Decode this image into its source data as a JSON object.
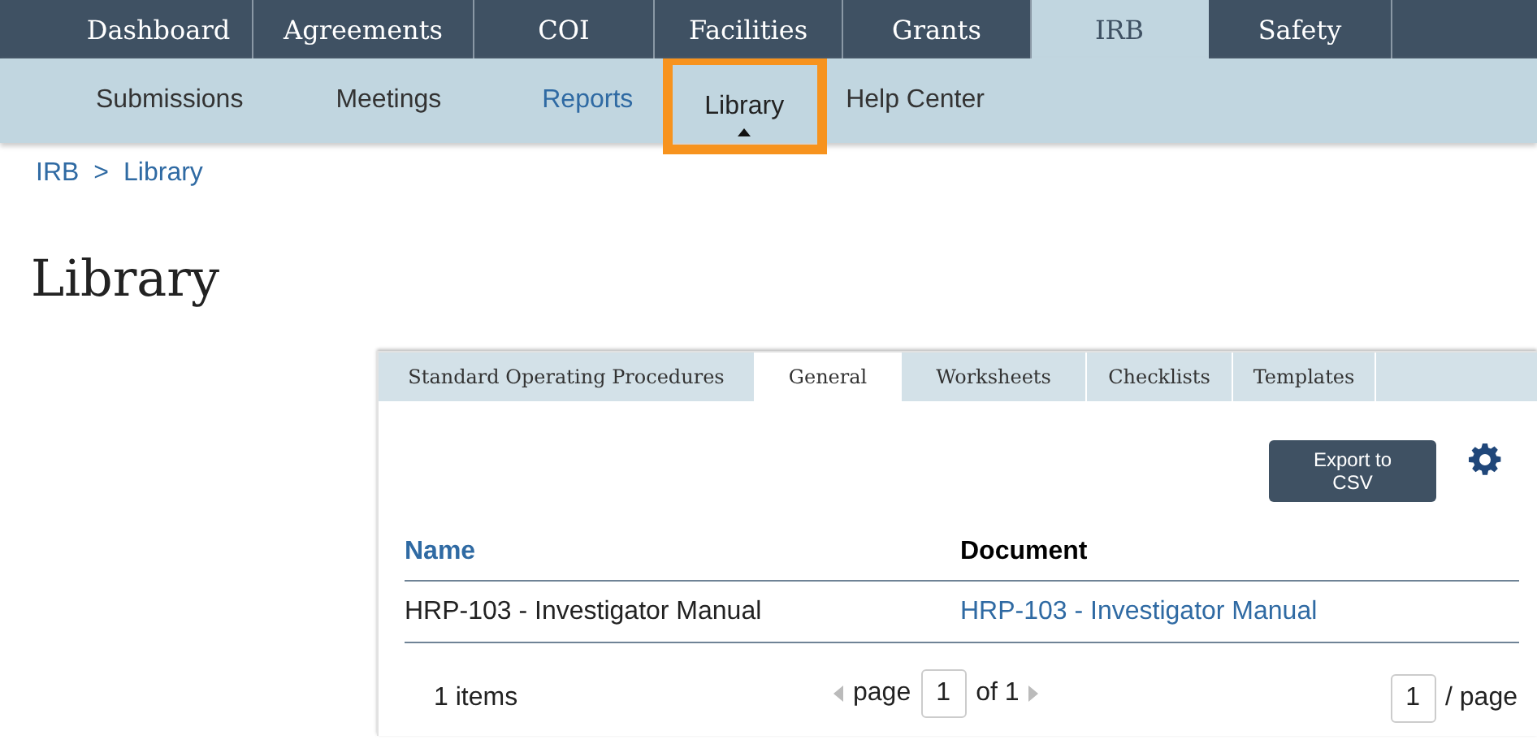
{
  "top_nav": [
    {
      "label": "Dashboard",
      "selected": false
    },
    {
      "label": "Agreements",
      "selected": false
    },
    {
      "label": "COI",
      "selected": false
    },
    {
      "label": "Facilities",
      "selected": false
    },
    {
      "label": "Grants",
      "selected": false
    },
    {
      "label": "IRB",
      "selected": true
    },
    {
      "label": "Safety",
      "selected": false
    }
  ],
  "sub_nav": [
    {
      "label": "Submissions",
      "selected": false,
      "hovered": false,
      "highlighted": false
    },
    {
      "label": "Meetings",
      "selected": false,
      "hovered": false,
      "highlighted": false
    },
    {
      "label": "Reports",
      "selected": false,
      "hovered": true,
      "highlighted": false
    },
    {
      "label": "Library",
      "selected": true,
      "hovered": false,
      "highlighted": true
    },
    {
      "label": "Help Center",
      "selected": false,
      "hovered": false,
      "highlighted": false
    }
  ],
  "breadcrumb": {
    "links": [
      "IRB",
      "Library"
    ],
    "separator": ">"
  },
  "page_title": "Library",
  "library_tabs": [
    {
      "label": "Standard Operating Procedures",
      "selected": false
    },
    {
      "label": "General",
      "selected": true
    },
    {
      "label": "Worksheets",
      "selected": false
    },
    {
      "label": "Checklists",
      "selected": false
    },
    {
      "label": "Templates",
      "selected": false
    }
  ],
  "export_button": "Export to CSV",
  "table": {
    "columns": [
      {
        "label": "Name",
        "sortable": true
      },
      {
        "label": "Document",
        "sortable": false
      }
    ],
    "rows": [
      [
        "HRP-103 - Investigator Manual",
        "HRP-103 - Investigator Manual"
      ]
    ]
  },
  "pagination": {
    "count": "1 items",
    "page_label": "page",
    "page": "1",
    "of_label": "of 1",
    "page_size": "1",
    "page_size_label": "/ page"
  }
}
